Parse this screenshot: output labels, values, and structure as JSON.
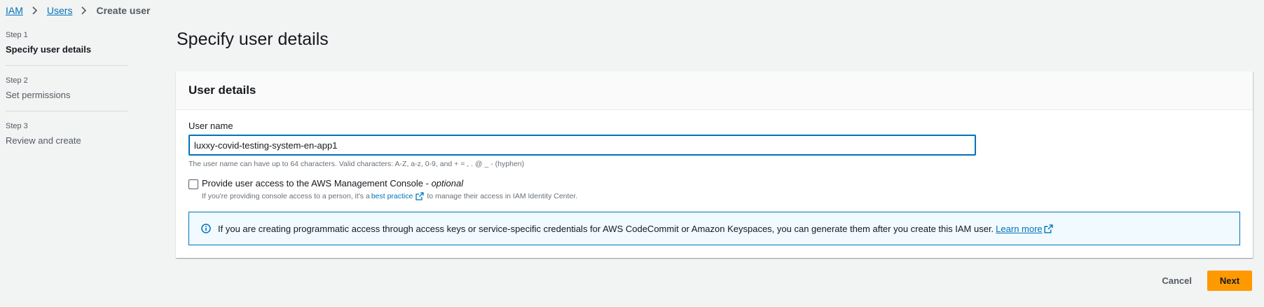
{
  "breadcrumb": {
    "items": [
      {
        "label": "IAM"
      },
      {
        "label": "Users"
      }
    ],
    "current": "Create user"
  },
  "steps": [
    {
      "number": "Step 1",
      "title": "Specify user details",
      "active": true
    },
    {
      "number": "Step 2",
      "title": "Set permissions",
      "active": false
    },
    {
      "number": "Step 3",
      "title": "Review and create",
      "active": false
    }
  ],
  "page": {
    "title": "Specify user details"
  },
  "user_details": {
    "header": "User details",
    "username": {
      "label": "User name",
      "value": "luxxy-covid-testing-system-en-app1",
      "hint": "The user name can have up to 64 characters. Valid characters: A-Z, a-z, 0-9, and + = , . @ _ - (hyphen)"
    },
    "console_access": {
      "label": "Provide user access to the AWS Management Console - ",
      "optional": "optional",
      "checked": false,
      "desc_before": "If you're providing console access to a person, it's a",
      "desc_link": "best practice",
      "desc_after": "to manage their access in IAM Identity Center."
    },
    "alert": {
      "text": "If you are creating programmatic access through access keys or service-specific credentials for AWS CodeCommit or Amazon Keyspaces, you can generate them after you create this IAM user.",
      "link": "Learn more"
    }
  },
  "actions": {
    "cancel": "Cancel",
    "next": "Next"
  },
  "colors": {
    "accent": "#0073bb",
    "primary_button": "#ff9900",
    "background": "#f2f3f3"
  },
  "icons": [
    "chevron-right-icon",
    "external-link-icon",
    "info-icon"
  ]
}
